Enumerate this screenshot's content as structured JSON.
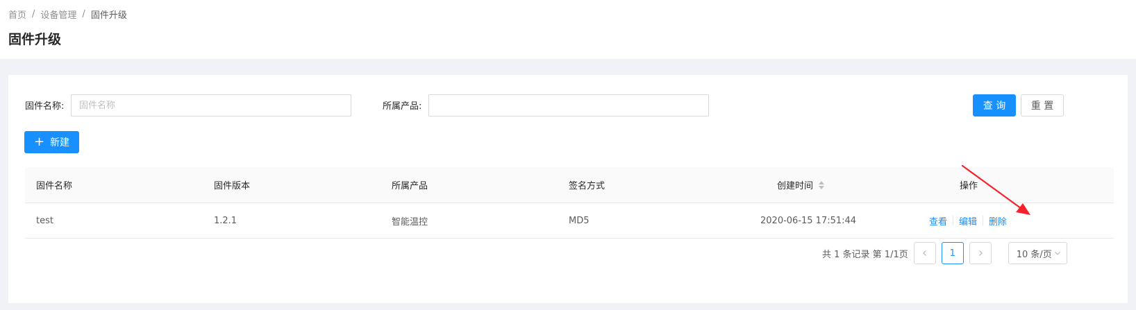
{
  "breadcrumb": {
    "items": [
      "首页",
      "设备管理",
      "固件升级"
    ],
    "separator": "/"
  },
  "page_title": "固件升级",
  "search": {
    "firmware_name_label": "固件名称:",
    "firmware_name_placeholder": "固件名称",
    "firmware_name_value": "",
    "product_label": "所属产品:",
    "product_value": "",
    "query_label": "查 询",
    "reset_label": "重 置"
  },
  "toolbar": {
    "new_label": "新建",
    "new_icon": "plus-icon"
  },
  "table": {
    "columns": [
      "固件名称",
      "固件版本",
      "所属产品",
      "签名方式",
      "创建时间",
      "操作"
    ],
    "rows": [
      {
        "name": "test",
        "version": "1.2.1",
        "product": "智能温控",
        "signature": "MD5",
        "created": "2020-06-15 17:51:44",
        "actions": [
          "查看",
          "编辑",
          "删除"
        ]
      }
    ]
  },
  "pagination": {
    "total_text": "共 1 条记录 第 1/1页",
    "current_page": "1",
    "page_size": "10 条/页"
  },
  "colors": {
    "primary": "#1890ff",
    "annotation_arrow": "#f5222d"
  }
}
